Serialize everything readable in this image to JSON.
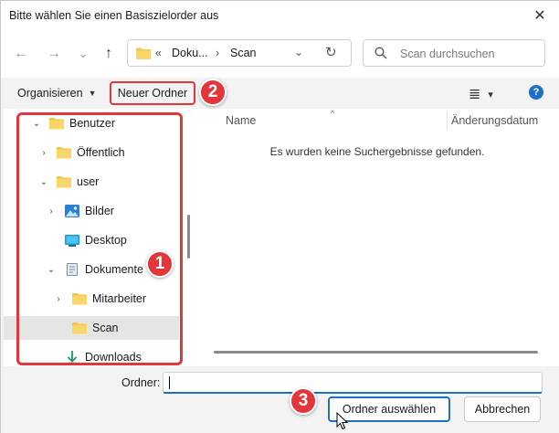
{
  "window": {
    "title": "Bitte wählen Sie einen Basiszielorder aus",
    "close_glyph": "✕"
  },
  "nav": {
    "back_glyph": "←",
    "forward_glyph": "→",
    "recent_glyph": "⌄",
    "up_glyph": "↑",
    "address": {
      "overflow": "«",
      "segment_1": "Doku...",
      "separator": "›",
      "segment_2": "Scan",
      "dropdown_glyph": "⌄",
      "refresh_glyph": "↻"
    },
    "search_placeholder": "Scan durchsuchen"
  },
  "toolbar": {
    "organize_label": "Organisieren",
    "organize_caret": "▼",
    "new_folder_label": "Neuer Ordner",
    "view_glyph": "≣",
    "view_caret": "▾",
    "help_glyph": "?"
  },
  "badges": {
    "one": "1",
    "two": "2",
    "three": "3"
  },
  "tree": {
    "items": [
      {
        "label": "Benutzer",
        "chevron": "⌄",
        "icon": "folder-icon"
      },
      {
        "label": "Öffentlich",
        "chevron": "›",
        "icon": "folder-icon"
      },
      {
        "label": "user",
        "chevron": "⌄",
        "icon": "folder-icon"
      },
      {
        "label": "Bilder",
        "chevron": "›",
        "icon": "pictures-icon"
      },
      {
        "label": "Desktop",
        "chevron": "",
        "icon": "desktop-icon"
      },
      {
        "label": "Dokumente",
        "chevron": "⌄",
        "icon": "documents-icon"
      },
      {
        "label": "Mitarbeiter",
        "chevron": "›",
        "icon": "folder-icon"
      },
      {
        "label": "Scan",
        "chevron": "",
        "icon": "folder-icon"
      },
      {
        "label": "Downloads",
        "chevron": "",
        "icon": "download-icon"
      }
    ]
  },
  "list": {
    "sort_glyph": "^",
    "col_name": "Name",
    "col_date": "Änderungsdatum",
    "empty_message": "Es wurden keine Suchergebnisse gefunden."
  },
  "footer": {
    "folder_label": "Ordner:",
    "folder_value": "",
    "select_button": "Ordner auswählen",
    "cancel_button": "Abbrechen"
  },
  "colors": {
    "accent": "#1d70c8",
    "highlight_red": "#e2363a",
    "folder_yellow": "#f3c74a",
    "selected_bg": "#e5e5e5"
  }
}
